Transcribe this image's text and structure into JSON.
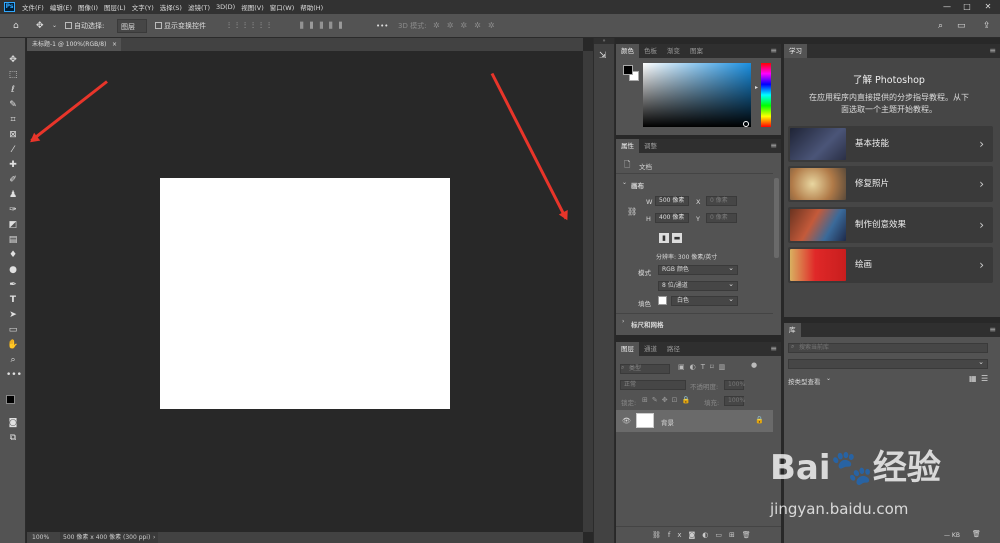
{
  "app": {
    "logo": "Ps"
  },
  "menu": [
    "文件(F)",
    "编辑(E)",
    "图像(I)",
    "图层(L)",
    "文字(Y)",
    "选择(S)",
    "滤镜(T)",
    "3D(D)",
    "视图(V)",
    "窗口(W)",
    "帮助(H)"
  ],
  "window_controls": {
    "minimize": "—",
    "maximize": "□",
    "close": "✕"
  },
  "options_bar": {
    "auto_select_label": "自动选择:",
    "auto_select_value": "图层",
    "show_transform_label": "显示变换控件",
    "mode_3d_label": "3D 模式:",
    "more": "•••"
  },
  "document": {
    "tab_title": "未标题-1 @ 100%(RGB/8)",
    "close": "×",
    "zoom": "100%",
    "info": "500 像素 x 400 像素 (300 ppi)",
    "info_arrow": "›"
  },
  "color_panel": {
    "tabs": [
      "颜色",
      "色板",
      "渐变",
      "图案"
    ],
    "active": 0
  },
  "properties_panel": {
    "tabs": [
      "属性",
      "调整"
    ],
    "doc_label": "文档",
    "canvas_section": "画布",
    "w_label": "W",
    "w_value": "500 像素",
    "h_label": "H",
    "h_value": "400 像素",
    "x_label": "X",
    "x_value": "0 像素",
    "y_label": "Y",
    "y_value": "0 像素",
    "resolution": "分辨率: 300 像素/英寸",
    "mode_label": "模式",
    "mode_value": "RGB 颜色",
    "depth_value": "8 位/通道",
    "fill_label": "填色",
    "fill_value": "白色",
    "rulers_section": "标尺和网格"
  },
  "layers_panel": {
    "tabs": [
      "图层",
      "通道",
      "路径"
    ],
    "filter_placeholder": "类型",
    "blend_value": "正常",
    "opacity_label": "不透明度:",
    "opacity_value": "100%",
    "lock_label": "锁定:",
    "fill_label": "填充:",
    "fill_value": "100%",
    "layer_name": "背景"
  },
  "learn_panel": {
    "tab": "学习",
    "title": "了解 Photoshop",
    "subtitle_1": "在应用程序内直接提供的分步指导教程。从下",
    "subtitle_2": "面选取一个主题开始教程。",
    "items": [
      "基本技能",
      "修复照片",
      "制作创意效果",
      "绘画"
    ]
  },
  "library_panel": {
    "tab": "库",
    "search_placeholder": "搜索当前库",
    "sort_label": "按类型查看",
    "size": "— KB"
  },
  "colors": {
    "accent_arrow": "#e8352a",
    "ps_blue": "#31a8ff"
  }
}
